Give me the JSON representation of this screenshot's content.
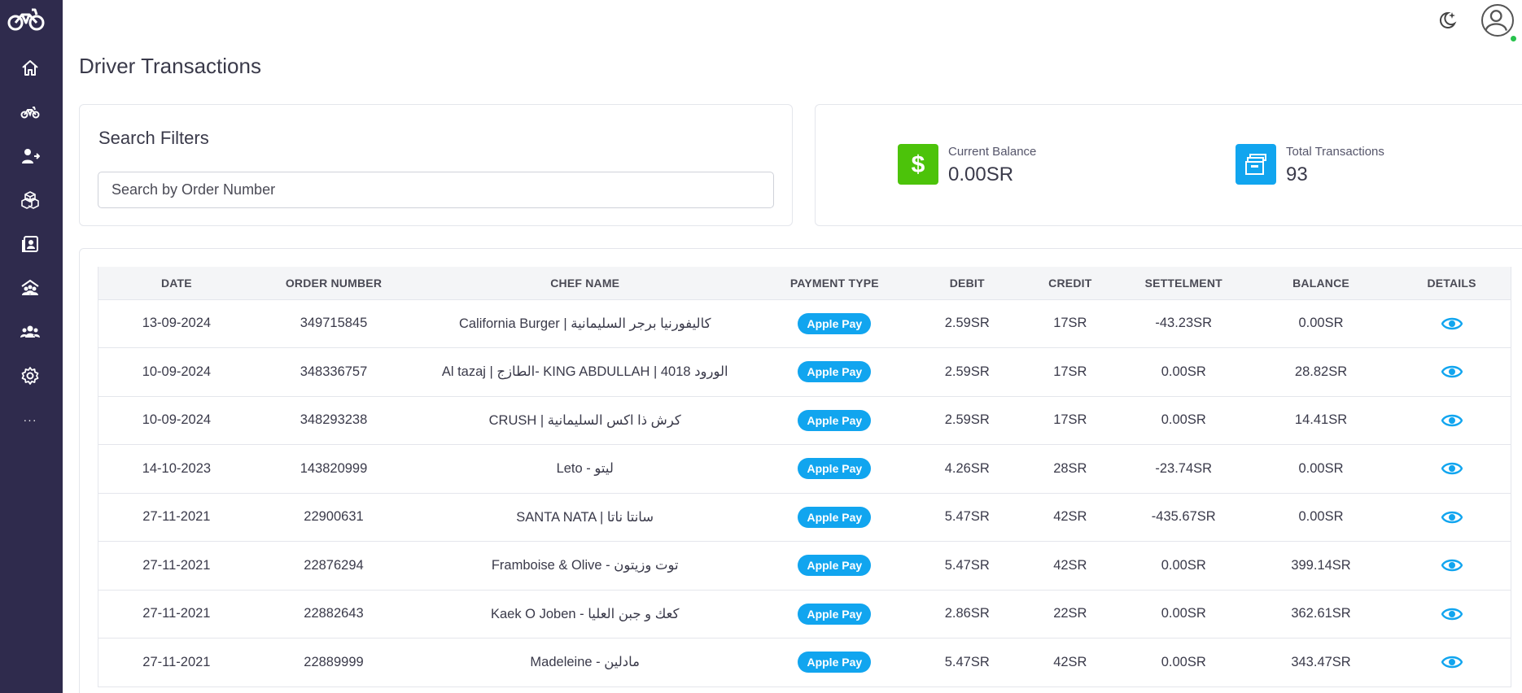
{
  "page": {
    "title": "Driver Transactions"
  },
  "colors": {
    "sidebar": "#2f2b4d",
    "accent_blue": "#11a5ef",
    "balance_green": "#4cc30a",
    "online": "#27c24c"
  },
  "sidebar": {
    "logo": "motorbike-logo",
    "items": [
      {
        "icon": "home-icon"
      },
      {
        "icon": "motorbike-icon"
      },
      {
        "icon": "user-transfer-icon"
      },
      {
        "icon": "boxes-icon"
      },
      {
        "icon": "contacts-book-icon"
      },
      {
        "icon": "group-icon"
      },
      {
        "icon": "users-icon"
      },
      {
        "icon": "settings-icon"
      }
    ],
    "more_label": "···"
  },
  "header": {
    "theme_icon": "moon-star-icon",
    "avatar_icon": "user-avatar-icon"
  },
  "filters": {
    "title": "Search Filters",
    "search_placeholder": "Search by Order Number",
    "search_value": ""
  },
  "stats": {
    "current_balance": {
      "label": "Current Balance",
      "value": "0.00SR",
      "icon": "dollar-icon"
    },
    "total_transactions": {
      "label": "Total Transactions",
      "value": "93",
      "icon": "archive-icon"
    }
  },
  "table": {
    "columns": [
      "Date",
      "Order Number",
      "Chef Name",
      "Payment Type",
      "Debit",
      "Credit",
      "Settelment",
      "Balance",
      "Details"
    ],
    "rows": [
      {
        "date": "13-09-2024",
        "order": "349715845",
        "chef": "California Burger | كاليفورنيا برجر السليمانية",
        "payment": "Apple Pay",
        "debit": "2.59SR",
        "credit": "17SR",
        "settlement": "-43.23SR",
        "balance": "0.00SR"
      },
      {
        "date": "10-09-2024",
        "order": "348336757",
        "chef": "Al tazaj | الطازج- KING ABDULLAH | 4018 الورود",
        "payment": "Apple Pay",
        "debit": "2.59SR",
        "credit": "17SR",
        "settlement": "0.00SR",
        "balance": "28.82SR"
      },
      {
        "date": "10-09-2024",
        "order": "348293238",
        "chef": "CRUSH | كرش ذا اكس السليمانية",
        "payment": "Apple Pay",
        "debit": "2.59SR",
        "credit": "17SR",
        "settlement": "0.00SR",
        "balance": "14.41SR"
      },
      {
        "date": "14-10-2023",
        "order": "143820999",
        "chef": "Leto - ليتو",
        "payment": "Apple Pay",
        "debit": "4.26SR",
        "credit": "28SR",
        "settlement": "-23.74SR",
        "balance": "0.00SR"
      },
      {
        "date": "27-11-2021",
        "order": "22900631",
        "chef": "SANTA NATA | سانتا ناتا",
        "payment": "Apple Pay",
        "debit": "5.47SR",
        "credit": "42SR",
        "settlement": "-435.67SR",
        "balance": "0.00SR"
      },
      {
        "date": "27-11-2021",
        "order": "22876294",
        "chef": "Framboise & Olive - توت وزيتون",
        "payment": "Apple Pay",
        "debit": "5.47SR",
        "credit": "42SR",
        "settlement": "0.00SR",
        "balance": "399.14SR"
      },
      {
        "date": "27-11-2021",
        "order": "22882643",
        "chef": "Kaek O Joben - كعك و جبن العليا",
        "payment": "Apple Pay",
        "debit": "2.86SR",
        "credit": "22SR",
        "settlement": "0.00SR",
        "balance": "362.61SR"
      },
      {
        "date": "27-11-2021",
        "order": "22889999",
        "chef": "Madeleine - مادلين",
        "payment": "Apple Pay",
        "debit": "5.47SR",
        "credit": "42SR",
        "settlement": "0.00SR",
        "balance": "343.47SR"
      }
    ]
  }
}
